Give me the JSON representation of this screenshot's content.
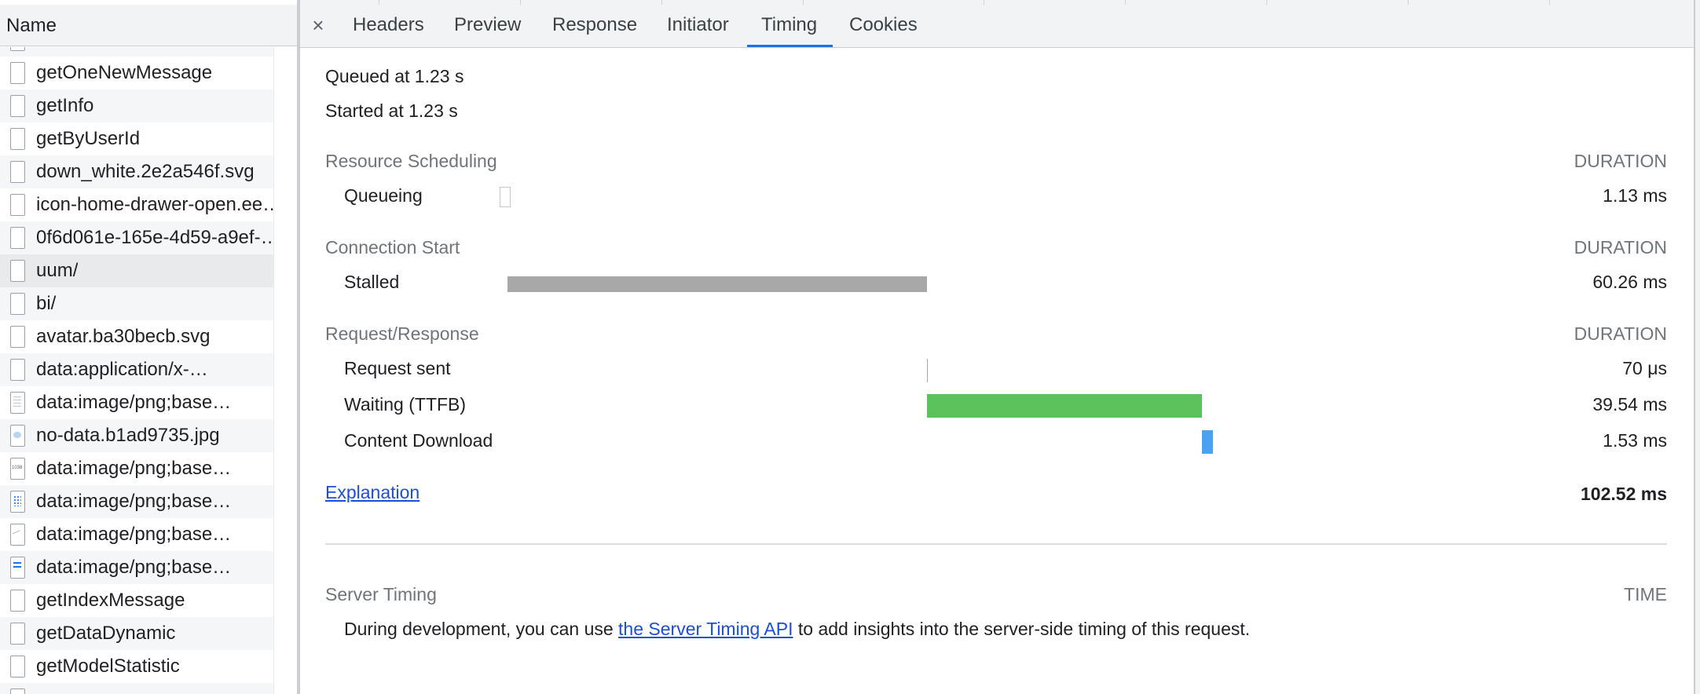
{
  "request_list": {
    "header": "Name",
    "items": [
      {
        "label": "getOneNewMessage",
        "icon": "file-icon"
      },
      {
        "label": "getInfo",
        "icon": "file-icon"
      },
      {
        "label": "getByUserId",
        "icon": "file-icon"
      },
      {
        "label": "down_white.2e2a546f.svg",
        "icon": "file-icon"
      },
      {
        "label": "icon-home-drawer-open.ee…",
        "icon": "file-icon"
      },
      {
        "label": "0f6d061e-165e-4d59-a9ef-…",
        "icon": "file-icon"
      },
      {
        "label": "uum/",
        "icon": "file-icon"
      },
      {
        "label": "bi/",
        "icon": "file-icon"
      },
      {
        "label": "avatar.ba30becb.svg",
        "icon": "file-icon"
      },
      {
        "label": "data:application/x-…",
        "icon": "file-icon"
      },
      {
        "label": "data:image/png;base…",
        "icon": "document-icon"
      },
      {
        "label": "no-data.b1ad9735.jpg",
        "icon": "image-icon"
      },
      {
        "label": "data:image/png;base…",
        "icon": "image-thumb-icon"
      },
      {
        "label": "data:image/png;base…",
        "icon": "dotted-image-icon"
      },
      {
        "label": "data:image/png;base…",
        "icon": "sketch-image-icon"
      },
      {
        "label": "data:image/png;base…",
        "icon": "blue-lines-image-icon"
      },
      {
        "label": "getIndexMessage",
        "icon": "file-icon"
      },
      {
        "label": "getDataDynamic",
        "icon": "file-icon"
      },
      {
        "label": "getModelStatistic",
        "icon": "file-icon"
      }
    ],
    "selected_label": "uum/"
  },
  "tabs": {
    "close": "×",
    "items": [
      "Headers",
      "Preview",
      "Response",
      "Initiator",
      "Timing",
      "Cookies"
    ],
    "active": "Timing"
  },
  "timing": {
    "queued_at": "Queued at 1.23 s",
    "started_at": "Started at 1.23 s",
    "duration_header": "DURATION",
    "sections": [
      {
        "title": "Resource Scheduling",
        "rows": [
          {
            "label": "Queueing",
            "value": "1.13 ms",
            "color": "#ffffff",
            "start_ms": 0,
            "duration_ms": 1.13
          }
        ]
      },
      {
        "title": "Connection Start",
        "rows": [
          {
            "label": "Stalled",
            "value": "60.26 ms",
            "color": "#a8a8a8",
            "start_ms": 1.13,
            "duration_ms": 60.26
          }
        ]
      },
      {
        "title": "Request/Response",
        "rows": [
          {
            "label": "Request sent",
            "value": "70 μs",
            "color": "#a8a8a8",
            "start_ms": 61.39,
            "duration_ms": 0.07
          },
          {
            "label": "Waiting (TTFB)",
            "value": "39.54 ms",
            "color": "#5cc35c",
            "start_ms": 61.46,
            "duration_ms": 39.54
          },
          {
            "label": "Content Download",
            "value": "1.53 ms",
            "color": "#4aa3f0",
            "start_ms": 101.0,
            "duration_ms": 1.53
          }
        ]
      }
    ],
    "explanation_link": "Explanation",
    "total": "102.52 ms",
    "server_timing": {
      "title": "Server Timing",
      "time_header": "TIME",
      "text_before": "During development, you can use ",
      "link_text": "the Server Timing API",
      "text_after": " to add insights into the server-side timing of this request."
    }
  }
}
